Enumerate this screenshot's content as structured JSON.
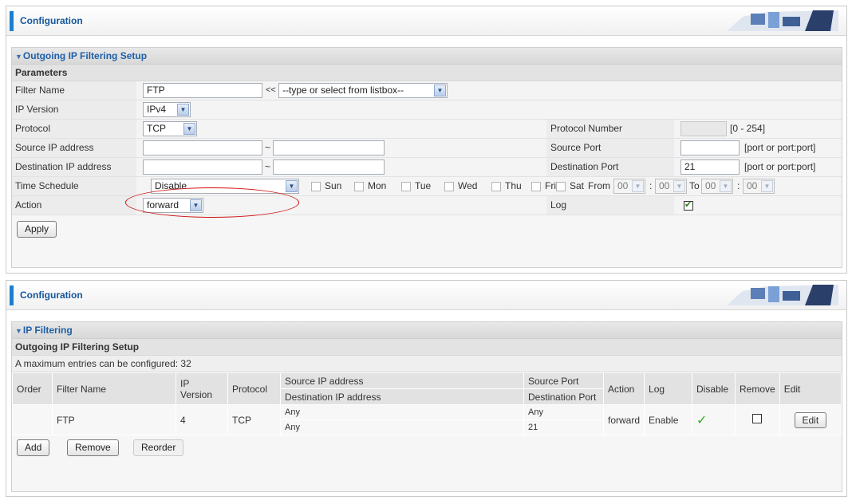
{
  "top_panel": {
    "header_title": "Configuration",
    "section_title": "Outgoing IP Filtering Setup",
    "parameters_title": "Parameters",
    "filter_name": {
      "label": "Filter Name",
      "value": "FTP",
      "arrows": "<<",
      "list_placeholder": "--type or select from listbox--"
    },
    "ip_version": {
      "label": "IP Version",
      "value": "IPv4"
    },
    "protocol": {
      "label": "Protocol",
      "value": "TCP"
    },
    "protocol_number": {
      "label": "Protocol Number",
      "value": "",
      "hint": "[0 - 254]"
    },
    "source_ip": {
      "label": "Source IP address",
      "start": "",
      "sep": "~",
      "end": ""
    },
    "source_port": {
      "label": "Source Port",
      "value": "",
      "hint": "[port or port:port]"
    },
    "dest_ip": {
      "label": "Destination IP address",
      "start": "",
      "sep": "~",
      "end": ""
    },
    "dest_port": {
      "label": "Destination Port",
      "value": "21",
      "hint": "[port or port:port]"
    },
    "time_schedule": {
      "label": "Time Schedule",
      "value": "Disable",
      "days": [
        "Sun",
        "Mon",
        "Tue",
        "Wed",
        "Thu",
        "Fri",
        "Sat"
      ],
      "from_label": "From",
      "to_label": "To",
      "from_hour": "00",
      "from_min": "00",
      "to_hour": "00",
      "to_min": "00",
      "colon": ":"
    },
    "action": {
      "label": "Action",
      "value": "forward"
    },
    "log": {
      "label": "Log",
      "checked": true
    },
    "apply_label": "Apply"
  },
  "bottom_panel": {
    "header_title": "Configuration",
    "section_title": "IP Filtering",
    "sub_title": "Outgoing IP Filtering Setup",
    "max_entries": "A maximum entries can be configured: 32",
    "columns": {
      "order": "Order",
      "filter_name": "Filter Name",
      "ip_version": "IP Version",
      "protocol": "Protocol",
      "source_ip": "Source IP address",
      "dest_ip": "Destination IP address",
      "source_port": "Source Port",
      "dest_port": "Destination Port",
      "action": "Action",
      "log": "Log",
      "disable": "Disable",
      "remove": "Remove",
      "edit": "Edit"
    },
    "rows": [
      {
        "order": "",
        "filter_name": "FTP",
        "ip_version": "4",
        "protocol": "TCP",
        "source_ip": "Any",
        "dest_ip": "Any",
        "source_port": "Any",
        "dest_port": "21",
        "action": "forward",
        "log": "Enable",
        "edit_label": "Edit"
      }
    ],
    "buttons": {
      "add": "Add",
      "remove": "Remove",
      "reorder": "Reorder"
    }
  },
  "colors": {
    "accent": "#1a7fd0",
    "title_blue": "#12569c",
    "highlight_circle": "#d01010"
  }
}
